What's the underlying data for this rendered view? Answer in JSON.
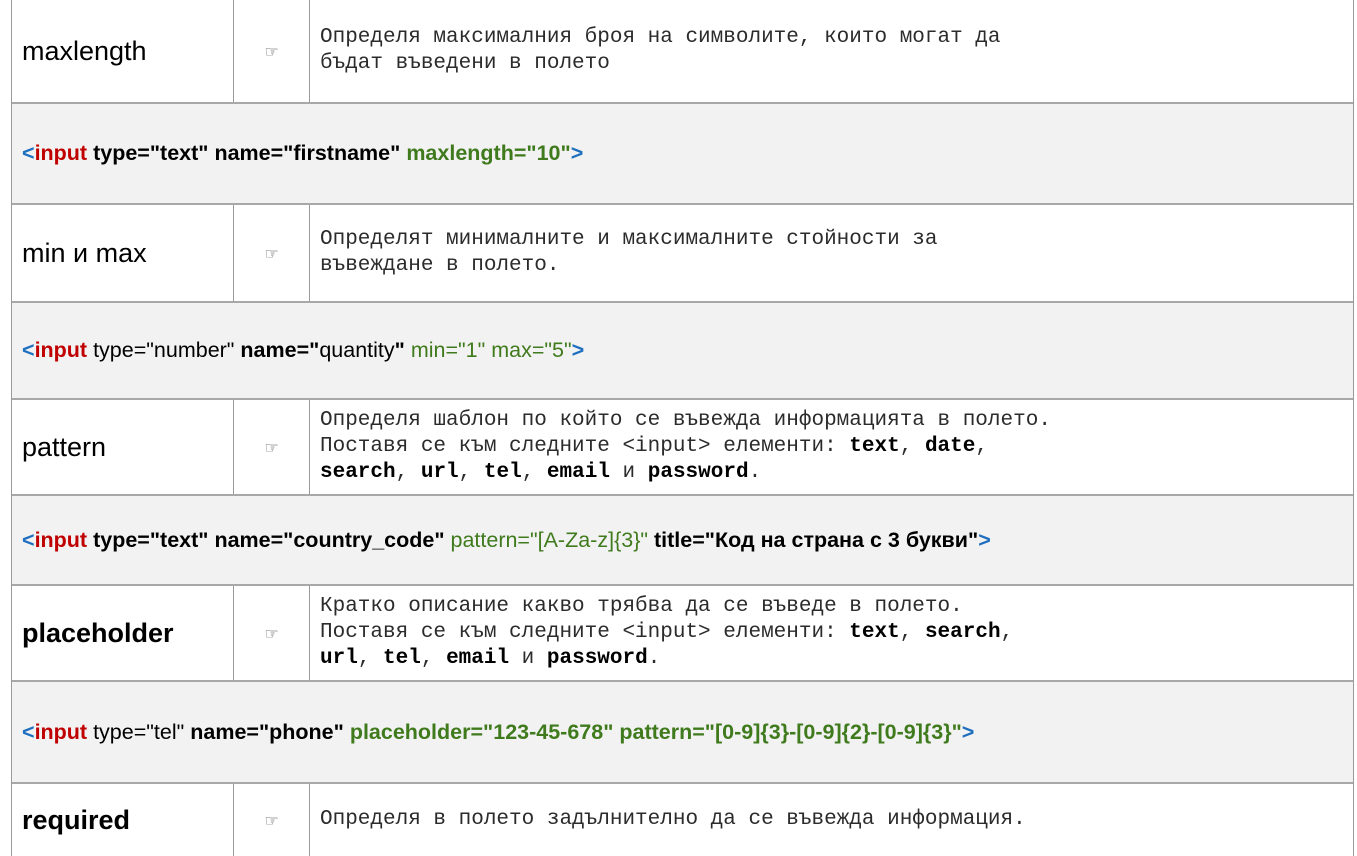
{
  "rows": [
    {
      "kind": "attr",
      "name": "maxlength",
      "bold": false,
      "hand": "☞",
      "desc": [
        [
          {
            "t": "Определя максималния броя на символите, които могат да",
            "b": false
          }
        ],
        [
          {
            "t": "бъдат въведени в полето",
            "b": false
          }
        ]
      ]
    },
    {
      "kind": "code",
      "tokens": [
        {
          "t": "<",
          "s": "bracket"
        },
        {
          "t": "input",
          "s": "tag"
        },
        {
          "t": " type=\"text\" name=\"firstname\" ",
          "s": "bold"
        },
        {
          "t": "maxlength=\"10\"",
          "s": "greenb"
        },
        {
          "t": ">",
          "s": "bracket"
        }
      ]
    },
    {
      "kind": "attr",
      "name": "min и max",
      "bold": false,
      "hand": "☞",
      "desc": [
        [
          {
            "t": "Определят минималните и максималните стойности за",
            "b": false
          }
        ],
        [
          {
            "t": "въвеждане в полетo.",
            "b": false
          }
        ]
      ]
    },
    {
      "kind": "code",
      "tokens": [
        {
          "t": "<",
          "s": "bracket"
        },
        {
          "t": "input",
          "s": "tag"
        },
        {
          "t": " type=\"number\" ",
          "s": "plain"
        },
        {
          "t": "name=\"",
          "s": "bold"
        },
        {
          "t": "quantity",
          "s": "plain"
        },
        {
          "t": "\" ",
          "s": "bold"
        },
        {
          "t": "min=\"1\" max=\"5\"",
          "s": "green"
        },
        {
          "t": ">",
          "s": "bracket"
        }
      ]
    },
    {
      "kind": "attr",
      "name": "pattern",
      "bold": false,
      "hand": "☞",
      "desc": [
        [
          {
            "t": "Определя шаблон по който се въвежда информацията в полето.",
            "b": false
          }
        ],
        [
          {
            "t": "Поставя се към следните <input> елементи: ",
            "b": false
          },
          {
            "t": "text",
            "b": true
          },
          {
            "t": ", ",
            "b": false
          },
          {
            "t": "date",
            "b": true
          },
          {
            "t": ",",
            "b": false
          }
        ],
        [
          {
            "t": "search",
            "b": true
          },
          {
            "t": ", ",
            "b": false
          },
          {
            "t": "url",
            "b": true
          },
          {
            "t": ", ",
            "b": false
          },
          {
            "t": "tel",
            "b": true
          },
          {
            "t": ", ",
            "b": false
          },
          {
            "t": "email",
            "b": true
          },
          {
            "t": " и ",
            "b": false
          },
          {
            "t": "password",
            "b": true
          },
          {
            "t": ".",
            "b": false
          }
        ]
      ]
    },
    {
      "kind": "code",
      "tokens": [
        {
          "t": "<",
          "s": "bracket"
        },
        {
          "t": "input",
          "s": "tag"
        },
        {
          "t": " type=\"text\" name=\"country_code\" ",
          "s": "bold"
        },
        {
          "t": "pattern=\"[A-Za-z]{3}\" ",
          "s": "green"
        },
        {
          "t": "title=\"Код на страна с 3 букви\"",
          "s": "bold"
        },
        {
          "t": ">",
          "s": "bracket"
        }
      ]
    },
    {
      "kind": "attr",
      "name": "placeholder",
      "bold": true,
      "hand": "☞",
      "desc": [
        [
          {
            "t": "Кратко описание какво трябва да се въведе в полето.",
            "b": false
          }
        ],
        [
          {
            "t": "Поставя се към следните <input> елементи: ",
            "b": false
          },
          {
            "t": "text",
            "b": true
          },
          {
            "t": ", ",
            "b": false
          },
          {
            "t": "search",
            "b": true
          },
          {
            "t": ",",
            "b": false
          }
        ],
        [
          {
            "t": "url",
            "b": true
          },
          {
            "t": ", ",
            "b": false
          },
          {
            "t": "tel",
            "b": true
          },
          {
            "t": ", ",
            "b": false
          },
          {
            "t": "email",
            "b": true
          },
          {
            "t": " и ",
            "b": false
          },
          {
            "t": "password",
            "b": true
          },
          {
            "t": ".",
            "b": false
          }
        ]
      ]
    },
    {
      "kind": "code",
      "tokens": [
        {
          "t": "<",
          "s": "bracket"
        },
        {
          "t": "input",
          "s": "tag"
        },
        {
          "t": " type=\"tel\" ",
          "s": "plain"
        },
        {
          "t": "name=\"phone\" ",
          "s": "bold"
        },
        {
          "t": "placeholder=\"123-45-678\" pattern=\"[0-9]{3}-[0-9]{2}-[0-9]{3}\"",
          "s": "greenb"
        },
        {
          "t": ">",
          "s": "bracket"
        }
      ]
    },
    {
      "kind": "attr",
      "name": "required",
      "bold": true,
      "hand": "☞",
      "desc": [
        [
          {
            "t": "Определя в полето задълнително да се въвежда информация.",
            "b": false
          }
        ]
      ]
    }
  ]
}
